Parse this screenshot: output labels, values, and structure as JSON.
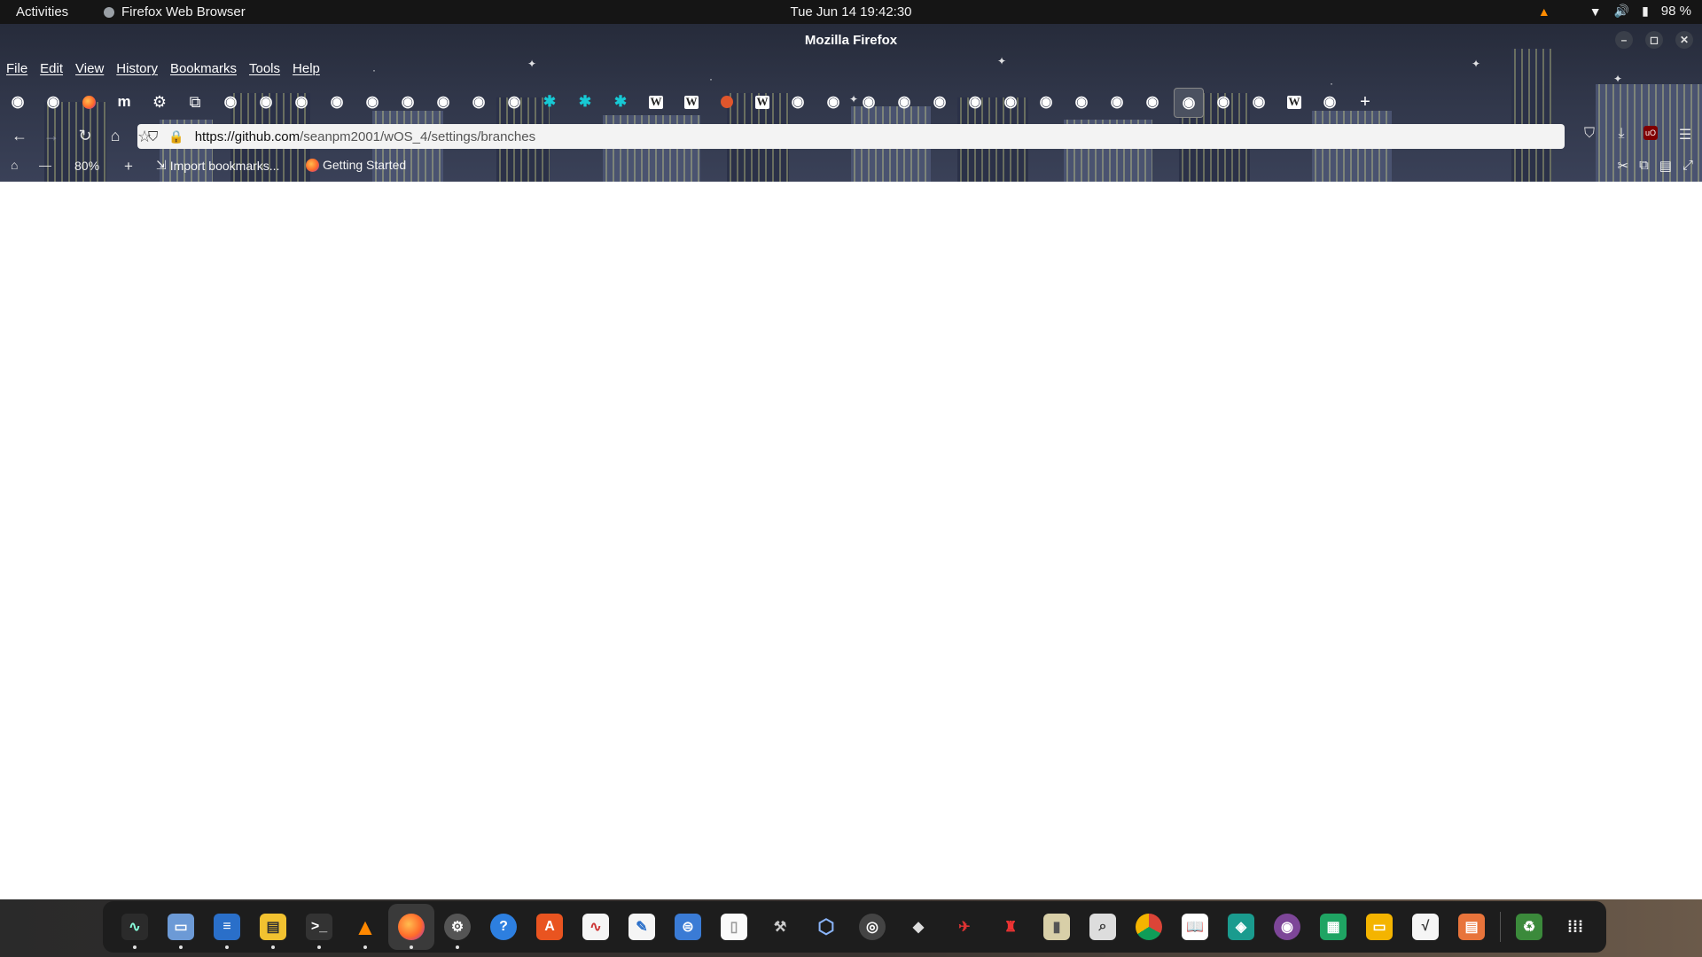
{
  "topbar": {
    "activities": "Activities",
    "app_name": "Firefox Web Browser",
    "clock": "Tue Jun 14  19:42:30",
    "battery": "98 %"
  },
  "window": {
    "title": "Mozilla Firefox"
  },
  "menu": {
    "items": [
      "File",
      "Edit",
      "View",
      "History",
      "Bookmarks",
      "Tools",
      "Help"
    ]
  },
  "tabs": {
    "icons": [
      "github",
      "github",
      "firefox",
      "mastodon",
      "settings",
      "extension",
      "github",
      "github",
      "github",
      "github",
      "github",
      "github",
      "github",
      "github",
      "github",
      "puzzle-cyan",
      "puzzle-cyan",
      "puzzle-cyan",
      "wikipedia",
      "wikipedia",
      "orange",
      "wikipedia",
      "github",
      "github",
      "github",
      "github",
      "github",
      "github",
      "github",
      "github",
      "github",
      "github",
      "github",
      "github",
      "github-active",
      "github",
      "github",
      "wikipedia",
      "github"
    ],
    "new_tab": "+"
  },
  "navbar": {
    "url_domain": "https://github.com",
    "url_path": "/seanpm2001/wOS_4/settings/branches"
  },
  "bookmarks": {
    "zoom": "80%",
    "import": "Import bookmarks...",
    "getting_started": "Getting Started"
  },
  "dock": {
    "apps": [
      "system-monitor",
      "files",
      "libreoffice-writer",
      "notes",
      "terminal",
      "vlc",
      "firefox",
      "settings",
      "help",
      "software",
      "graph",
      "text-editor",
      "tweaks",
      "document",
      "tool",
      "virtualbox",
      "disk",
      "inkscape",
      "racing-game",
      "mario-game",
      "archive",
      "image-viewer",
      "chrome",
      "books",
      "app-teal",
      "tor",
      "spreadsheet",
      "slides",
      "math",
      "presentation",
      "trash",
      "app-grid"
    ]
  }
}
